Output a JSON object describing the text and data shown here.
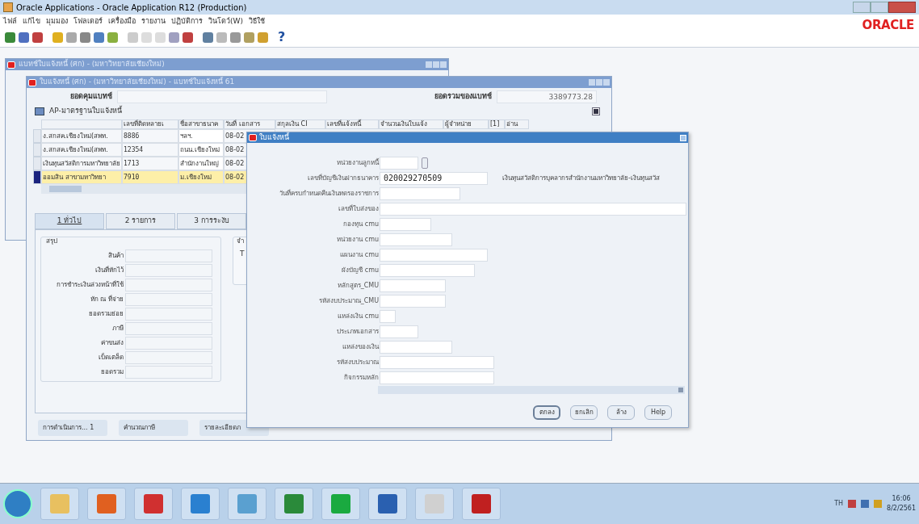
{
  "window": {
    "title": "Oracle Applications - Oracle Application R12 (Production)",
    "brand": "ORACLE"
  },
  "menu": [
    "ไฟล์",
    "แก้ไข",
    "มุมมอง",
    "โฟลเดอร์",
    "เครื่องมือ",
    "รายงาน",
    "ปฏิบัติการ",
    "วินโดว์(W)",
    "วิธีใช้"
  ],
  "toolbar": {
    "help": "?"
  },
  "batch_window": {
    "title": "แบทช์ใบแจ้งหนี้ (ศก) - (มหาวิทยาลัยเชียงใหม่)"
  },
  "invoice_window": {
    "title": "ใบแจ้งหนี้ (ศก) - (มหาวิทยาลัยเชียงใหม่) - แบทช์ใบแจ้งหนี้ 61",
    "batch_control_label": "ยอดคุมแบทช์",
    "batch_total_label": "ยอดรวมของแบทช์",
    "batch_total": "3389773.28",
    "folder": "AP-มาตรฐานใบแจ้งหนี้",
    "folder_checked": true,
    "table": {
      "columns": [
        "",
        "เลขที่ติดหลายเ",
        "ชื่อสาขาธนาค",
        "วันที่ เอกสาร",
        "สกุลเงิน CI",
        "เลขที่แจ้งหนี้",
        "จำนวนเงินใบแจ้ง",
        "ผู้จำหน่าย",
        "[1]",
        "อ่าน"
      ],
      "rows": [
        {
          "cells": [
            "ง.สกสค.เชียงใหม่(สพท.",
            "8886",
            "ฯลฯ.",
            "08-02"
          ],
          "selected": false
        },
        {
          "cells": [
            "ง.สกสค.เชียงใหม่(สพท.",
            "12354",
            "ถนน.เชียงใหม่",
            "08-02"
          ],
          "selected": false
        },
        {
          "cells": [
            "เงินทุนสวัสดิการมหาวิทยาลัย",
            "1713",
            "สำนักงานใหญ่",
            "08-02"
          ],
          "selected": false
        },
        {
          "cells": [
            "ออมสิน สาขามหาวิทยา",
            "7910",
            "ม.เชียงใหม่",
            "08-02"
          ],
          "selected": true
        }
      ]
    },
    "tabs": [
      {
        "label": "1 ทั่วไป",
        "selected": true
      },
      {
        "label": "2 รายการ",
        "selected": false
      },
      {
        "label": "3 การระงับ",
        "selected": false
      }
    ],
    "summary": {
      "title": "สรุป",
      "fields": [
        "สินค้า",
        "เงินที่หักไว้",
        "การชำระเงินล่วงหน้าที่ใช้",
        "หัก ณ ที่จ่าย",
        "ยอดรวมย่อย",
        "ภาษี",
        "ค่าขนส่ง",
        "เบ็ดเตล็ด",
        "ยอดรวม"
      ]
    },
    "side_group": {
      "title": "จำ",
      "text": "T"
    },
    "buttons": [
      "การดำเนินการ... 1",
      "คำนวณภาษี",
      "รายละเอียดภ"
    ]
  },
  "dialog": {
    "title": "ใบแจ้งหนี้",
    "fields": [
      {
        "label": "หน่วยงานลูกหนี้",
        "kind": "lov"
      },
      {
        "label": "เลขที่บัญชีเงินฝากธนาคาร",
        "value": "020029270509",
        "description": "เงินทุนสวัสดิการบุคลากรสำนักงานมหาวิทยาลัย-เงินทุนสวัส"
      },
      {
        "label": "วันที่ครบกำหนดคืนเงินทดรองราชการ"
      },
      {
        "label": "เลขที่ใบส่งของ"
      },
      {
        "label": "กองทุน cmu"
      },
      {
        "label": "หน่วยงาน cmu"
      },
      {
        "label": "แผนงาน cmu"
      },
      {
        "label": "ผังบัญชี cmu"
      },
      {
        "label": "หลักสูตร_CMU"
      },
      {
        "label": "รหัสงบประมาณ_CMU"
      },
      {
        "label": "แหล่งเงิน cmu"
      },
      {
        "label": "ประเภทเอกสาร"
      },
      {
        "label": "แหล่งของเงิน"
      },
      {
        "label": "รหัสงบประมาณ"
      },
      {
        "label": "กิจกรรมหลัก"
      }
    ],
    "buttons": [
      {
        "label": "ตกลง",
        "selected": true
      },
      {
        "label": "ยกเลิก",
        "selected": false
      },
      {
        "label": "ล้าง",
        "selected": false
      },
      {
        "label": "Help",
        "selected": false
      }
    ]
  },
  "taskbar": {
    "language": "TH",
    "time": "16:06",
    "date": "8/2/2561"
  }
}
